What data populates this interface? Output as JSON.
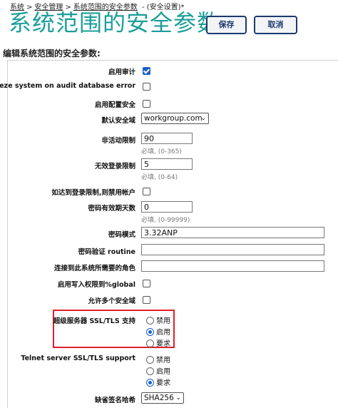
{
  "breadcrumb": {
    "items": [
      "系统",
      "安全管理",
      "系统范围的安全参数"
    ],
    "suffix": "- (安全设置)*"
  },
  "page_title": "系统范围的安全参数",
  "toolbar": {
    "save_label": "保存",
    "cancel_label": "取消"
  },
  "section_title": "编辑系统范围的安全参数:",
  "fields": {
    "enable_audit": {
      "label": "启用审计",
      "checked": true
    },
    "freeze_system": {
      "label": "Freeze system on audit database error",
      "checked": false
    },
    "enable_config_security": {
      "label": "启用配置安全",
      "checked": false
    },
    "default_security_domain": {
      "label": "默认安全域",
      "value": "workgroup.com"
    },
    "inactivity_limit": {
      "label": "非活动限制",
      "value": "90",
      "hint": "必填, (0-365)"
    },
    "invalid_login_limit": {
      "label": "无效登录限制",
      "value": "5",
      "hint": "必填, (0-64)"
    },
    "disable_on_limit": {
      "label": "如达到登录限制,则禁用帐户",
      "checked": false
    },
    "password_days": {
      "label": "密码有效期天数",
      "value": "0",
      "hint": "必填, (0-99999)"
    },
    "password_pattern": {
      "label": "密码模式",
      "value": "3.32ANP"
    },
    "password_routine": {
      "label": "密码验证 routine",
      "value": ""
    },
    "connect_role": {
      "label": "连接到此系统所需要的角色",
      "value": ""
    },
    "global_write": {
      "label": "启用写入权限到%global",
      "checked": false
    },
    "allow_multi_domain": {
      "label": "允许多个安全域",
      "checked": false
    },
    "superserver_tls": {
      "label": "超级服务器 SSL/TLS 支持",
      "options": [
        "禁用",
        "启用",
        "要求"
      ],
      "selected": "启用"
    },
    "telnet_tls": {
      "label": "Telnet server SSL/TLS support",
      "options": [
        "禁用",
        "启用",
        "要求"
      ],
      "selected": "要求"
    },
    "default_signature_hash": {
      "label": "缺省签名哈希",
      "value": "SHA256"
    }
  }
}
